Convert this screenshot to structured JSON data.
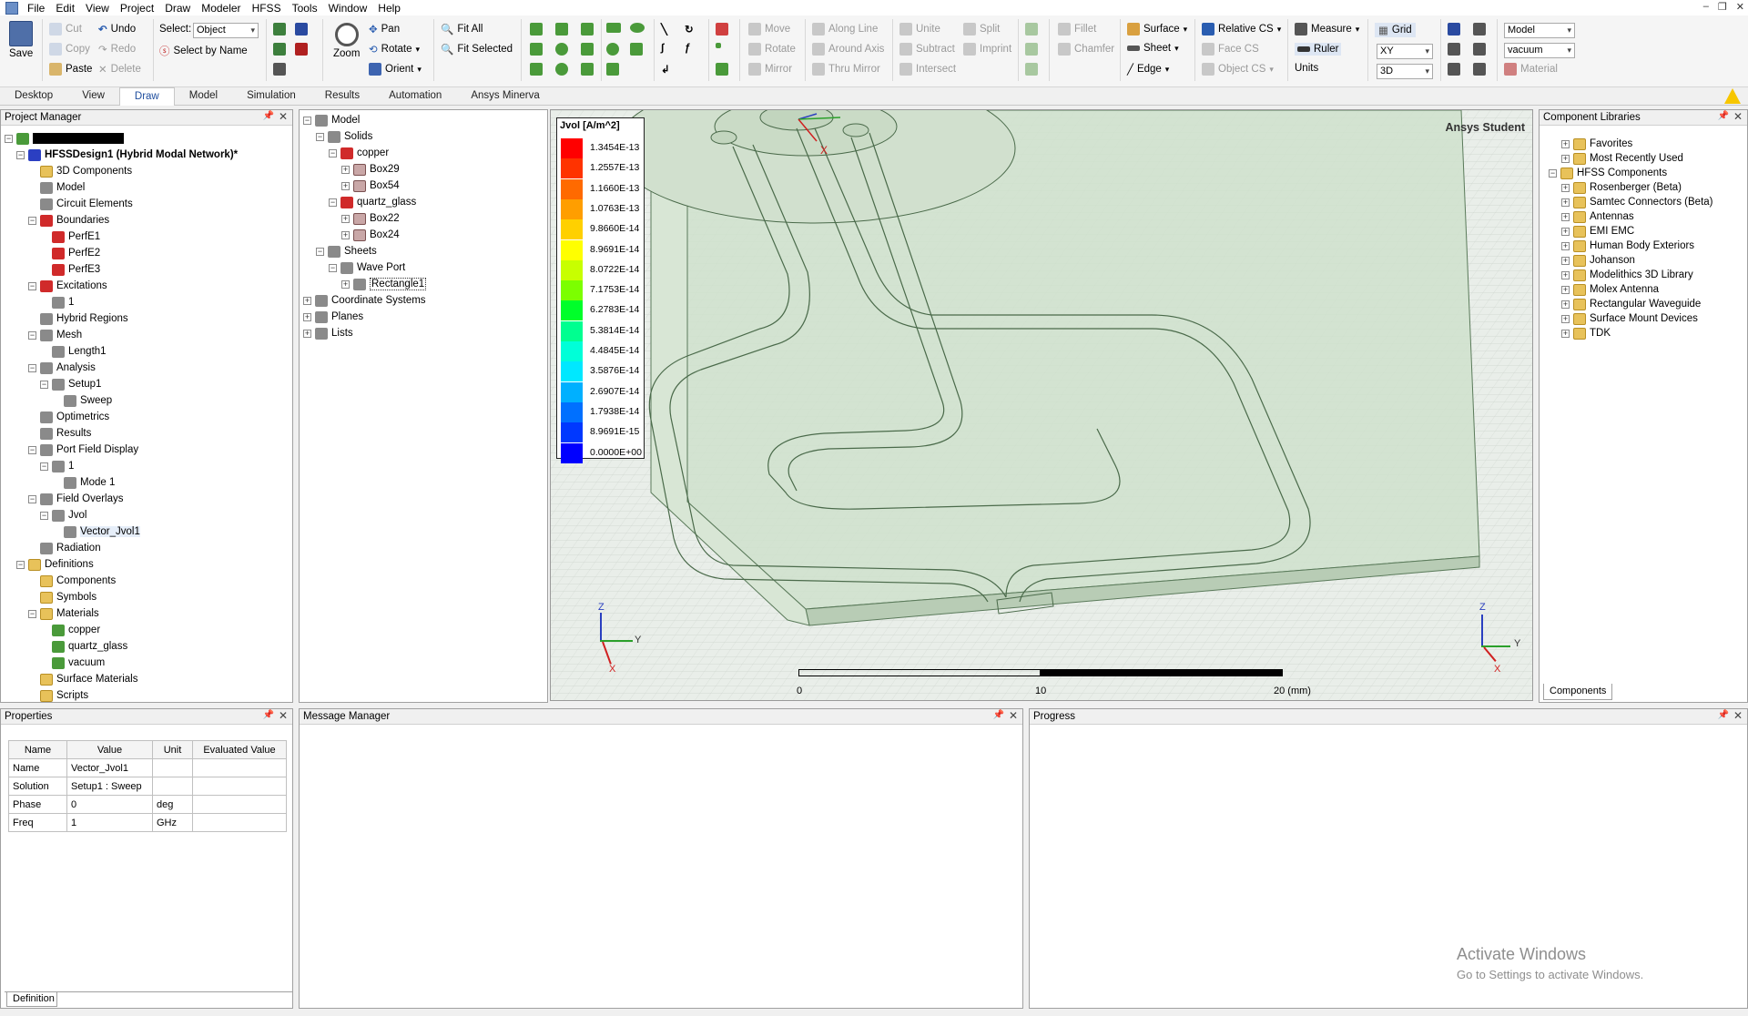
{
  "menu": [
    "File",
    "Edit",
    "View",
    "Project",
    "Draw",
    "Modeler",
    "HFSS",
    "Tools",
    "Window",
    "Help"
  ],
  "ribbon": {
    "save": "Save",
    "cut": "Cut",
    "copy": "Copy",
    "paste": "Paste",
    "undo": "Undo",
    "redo": "Redo",
    "delete": "Delete",
    "select_label": "Select:",
    "select_value": "Object",
    "select_by_name": "Select by Name",
    "zoom": "Zoom",
    "pan": "Pan",
    "rotate": "Rotate",
    "orient": "Orient",
    "fit_all": "Fit All",
    "fit_selected": "Fit Selected",
    "move": "Move",
    "rotate2": "Rotate",
    "mirror": "Mirror",
    "along_axis": "Along Line",
    "around_axis": "Around Axis",
    "thru_mirror": "Thru Mirror",
    "unite": "Unite",
    "subtract": "Subtract",
    "intersect": "Intersect",
    "split": "Split",
    "imprint": "Imprint",
    "fillet": "Fillet",
    "chamfer": "Chamfer",
    "surface": "Surface",
    "sheet": "Sheet",
    "edge": "Edge",
    "relative_cs": "Relative CS",
    "face_cs": "Face CS",
    "object_cs": "Object CS",
    "measure": "Measure",
    "ruler": "Ruler",
    "units": "Units",
    "grid": "Grid",
    "plane_value": "XY",
    "dim_value": "3D",
    "model_value": "Model",
    "material_value": "vacuum",
    "material": "Material"
  },
  "tabs": [
    "Desktop",
    "View",
    "Draw",
    "Model",
    "Simulation",
    "Results",
    "Automation",
    "Ansys Minerva"
  ],
  "active_tab": "Draw",
  "project_manager": {
    "title": "Project Manager",
    "items": [
      {
        "label": "",
        "level": 0
      },
      {
        "label": "HFSSDesign1 (Hybrid Modal Network)*",
        "level": 1
      },
      {
        "label": "3D Components",
        "level": 2
      },
      {
        "label": "Model",
        "level": 2
      },
      {
        "label": "Circuit Elements",
        "level": 2
      },
      {
        "label": "Boundaries",
        "level": 2
      },
      {
        "label": "PerfE1",
        "level": 3
      },
      {
        "label": "PerfE2",
        "level": 3
      },
      {
        "label": "PerfE3",
        "level": 3
      },
      {
        "label": "Excitations",
        "level": 2
      },
      {
        "label": "1",
        "level": 3
      },
      {
        "label": "Hybrid Regions",
        "level": 2
      },
      {
        "label": "Mesh",
        "level": 2
      },
      {
        "label": "Length1",
        "level": 3
      },
      {
        "label": "Analysis",
        "level": 2
      },
      {
        "label": "Setup1",
        "level": 3
      },
      {
        "label": "Sweep",
        "level": 4
      },
      {
        "label": "Optimetrics",
        "level": 2
      },
      {
        "label": "Results",
        "level": 2
      },
      {
        "label": "Port Field Display",
        "level": 2
      },
      {
        "label": "1",
        "level": 3
      },
      {
        "label": "Mode 1",
        "level": 4
      },
      {
        "label": "Field Overlays",
        "level": 2
      },
      {
        "label": "Jvol",
        "level": 3
      },
      {
        "label": "Vector_Jvol1",
        "level": 4
      },
      {
        "label": "Radiation",
        "level": 2
      },
      {
        "label": "Definitions",
        "level": 1
      },
      {
        "label": "Components",
        "level": 2
      },
      {
        "label": "Symbols",
        "level": 2
      },
      {
        "label": "Materials",
        "level": 2
      },
      {
        "label": "copper",
        "level": 3
      },
      {
        "label": "quartz_glass",
        "level": 3
      },
      {
        "label": "vacuum",
        "level": 3
      },
      {
        "label": "Surface Materials",
        "level": 2
      },
      {
        "label": "Scripts",
        "level": 2
      }
    ]
  },
  "model_tree": {
    "items": [
      {
        "label": "Model",
        "level": 0
      },
      {
        "label": "Solids",
        "level": 1
      },
      {
        "label": "copper",
        "level": 2
      },
      {
        "label": "Box29",
        "level": 3
      },
      {
        "label": "Box54",
        "level": 3
      },
      {
        "label": "quartz_glass",
        "level": 2
      },
      {
        "label": "Box22",
        "level": 3
      },
      {
        "label": "Box24",
        "level": 3
      },
      {
        "label": "Sheets",
        "level": 1
      },
      {
        "label": "Wave Port",
        "level": 2
      },
      {
        "label": "Rectangle1",
        "level": 3
      },
      {
        "label": "Coordinate Systems",
        "level": 0
      },
      {
        "label": "Planes",
        "level": 0
      },
      {
        "label": "Lists",
        "level": 0
      }
    ]
  },
  "viewport": {
    "watermark": "Ansys Student",
    "legend_title": "Jvol [A/m^2]",
    "legend_values": [
      "1.3454E-13",
      "1.2557E-13",
      "1.1660E-13",
      "1.0763E-13",
      "9.8660E-14",
      "8.9691E-14",
      "8.0722E-14",
      "7.1753E-14",
      "6.2783E-14",
      "5.3814E-14",
      "4.4845E-14",
      "3.5876E-14",
      "2.6907E-14",
      "1.7938E-14",
      "8.9691E-15",
      "0.0000E+00"
    ],
    "legend_colors": [
      "#ff0000",
      "#ff3300",
      "#ff6a00",
      "#ff9e00",
      "#ffd000",
      "#ffff00",
      "#c8ff00",
      "#7cff00",
      "#00ff2a",
      "#00ff90",
      "#00ffd8",
      "#00e8ff",
      "#00b0ff",
      "#0070ff",
      "#0038ff",
      "#0000ff"
    ],
    "scale_labels": [
      "0",
      "10",
      "20 (mm)"
    ],
    "axis_labels": {
      "z": "Z",
      "y": "Y",
      "x": "X"
    }
  },
  "component_libraries": {
    "title": "Component Libraries",
    "items": [
      {
        "label": "Favorites",
        "level": 1
      },
      {
        "label": "Most Recently Used",
        "level": 1
      },
      {
        "label": "HFSS Components",
        "level": 0
      },
      {
        "label": "Rosenberger (Beta)",
        "level": 1
      },
      {
        "label": "Samtec Connectors (Beta)",
        "level": 1
      },
      {
        "label": "Antennas",
        "level": 1
      },
      {
        "label": "EMI EMC",
        "level": 1
      },
      {
        "label": "Human Body Exteriors",
        "level": 1
      },
      {
        "label": "Johanson",
        "level": 1
      },
      {
        "label": "Modelithics 3D Library",
        "level": 1
      },
      {
        "label": "Molex Antenna",
        "level": 1
      },
      {
        "label": "Rectangular Waveguide",
        "level": 1
      },
      {
        "label": "Surface Mount Devices",
        "level": 1
      },
      {
        "label": "TDK",
        "level": 1
      }
    ],
    "tab": "Components"
  },
  "properties": {
    "title": "Properties",
    "headers": [
      "Name",
      "Value",
      "Unit",
      "Evaluated Value"
    ],
    "rows": [
      [
        "Name",
        "Vector_Jvol1",
        "",
        ""
      ],
      [
        "Solution",
        "Setup1 : Sweep",
        "",
        ""
      ],
      [
        "Phase",
        "0",
        "deg",
        ""
      ],
      [
        "Freq",
        "1",
        "GHz",
        ""
      ]
    ],
    "tab": "Definition"
  },
  "message_manager": {
    "title": "Message Manager"
  },
  "progress": {
    "title": "Progress"
  },
  "activate_windows": {
    "line1": "Activate Windows",
    "line2": "Go to Settings to activate Windows."
  }
}
